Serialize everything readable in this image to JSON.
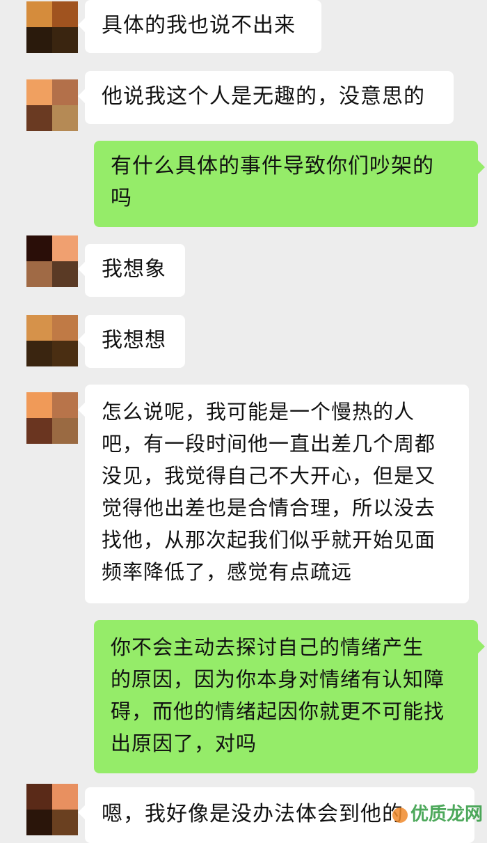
{
  "messages": [
    {
      "side": "left",
      "text": "具体的我也说不出来",
      "avatar": [
        "#d58c3c",
        "#a0531f",
        "#2a1a0c",
        "#3a2510"
      ]
    },
    {
      "side": "left",
      "text": "他说我这个人是无趣的，没意思的",
      "avatar": [
        "#f0a060",
        "#b3704a",
        "#6a3a22",
        "#b58a55"
      ]
    },
    {
      "side": "right",
      "text": "有什么具体的事件导致你们吵架的\n吗"
    },
    {
      "side": "left",
      "text": "我想象",
      "avatar": [
        "#2a0e08",
        "#f0a070",
        "#a06a45",
        "#5a3a25"
      ]
    },
    {
      "side": "left",
      "text": "我想想",
      "avatar": [
        "#d6924a",
        "#c07a45",
        "#3a2510",
        "#4a2e12"
      ]
    },
    {
      "side": "left",
      "text": "怎么说呢，我可能是一个慢热的人\n吧，有一段时间他一直出差几个周都\n没见，我觉得自己不大开心，但是又\n觉得他出差也是合情合理，所以没去\n找他，从那次起我们似乎就开始见面\n频率降低了，感觉有点疏远",
      "avatar": [
        "#f09a58",
        "#b8744a",
        "#6a3520",
        "#9a6a42"
      ]
    },
    {
      "side": "right",
      "text": "你不会主动去探讨自己的情绪产生\n的原因，因为你本身对情绪有认知障\n碍，而他的情绪起因你就更不可能找\n出原因了，对吗"
    },
    {
      "side": "left",
      "text": "嗯，我好像是没办法体会到他的",
      "avatar": [
        "#5a2a18",
        "#e89060",
        "#2a150a",
        "#6a4020"
      ]
    }
  ],
  "watermark": "优质龙网"
}
